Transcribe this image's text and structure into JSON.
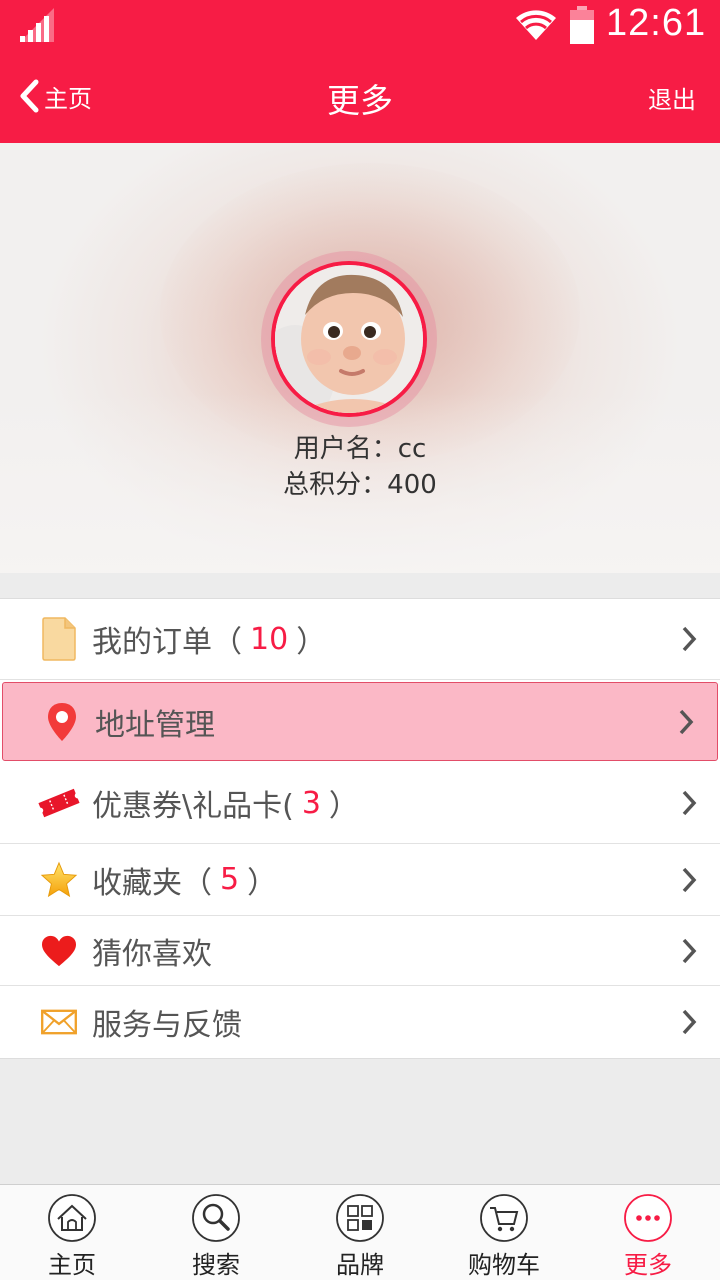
{
  "status_bar": {
    "time": "12:61"
  },
  "nav": {
    "back_label": "主页",
    "title": "更多",
    "logout_label": "退出"
  },
  "profile": {
    "username_label": "用户名：cc",
    "points_label": "总积分：400"
  },
  "menu": {
    "orders": {
      "label": "我的订单（",
      "count": "10",
      "suffix": "）"
    },
    "address": {
      "label": "地址管理"
    },
    "coupons": {
      "label": "优惠券\\礼品卡(",
      "count": "3",
      "suffix": "）"
    },
    "favorites": {
      "label": "收藏夹（",
      "count": "5",
      "suffix": "）"
    },
    "recommend": {
      "label": "猜你喜欢"
    },
    "feedback": {
      "label": "服务与反馈"
    }
  },
  "tabs": {
    "home": "主页",
    "search": "搜索",
    "brand": "品牌",
    "cart": "购物车",
    "more": "更多"
  },
  "colors": {
    "accent": "#f71c45",
    "highlight": "#fbb8c6"
  }
}
